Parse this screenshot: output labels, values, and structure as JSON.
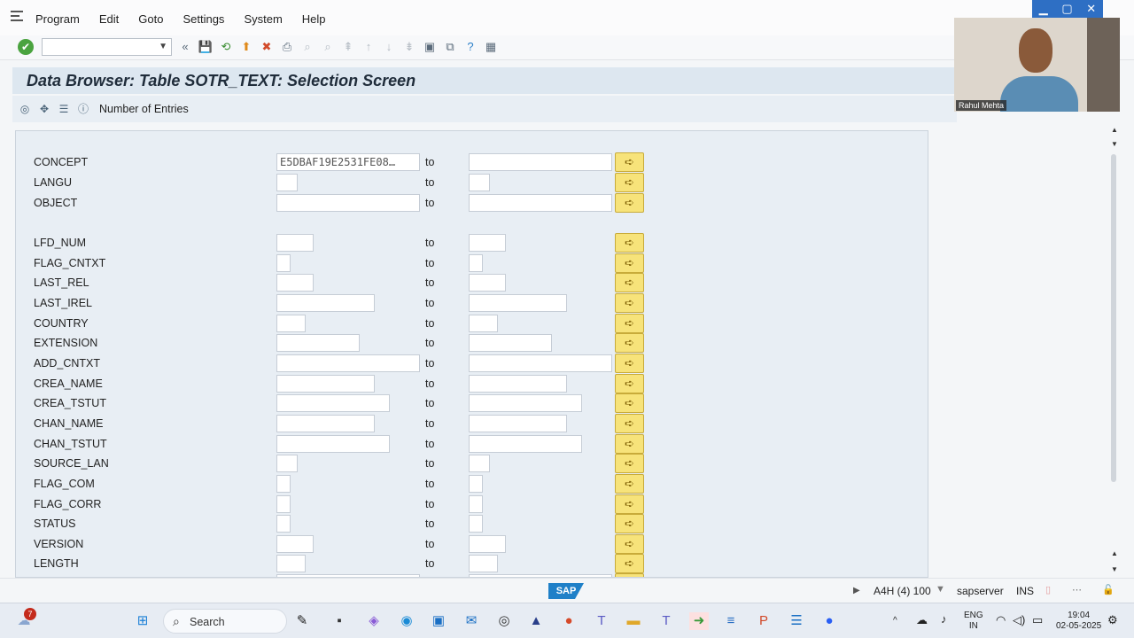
{
  "menubar": {
    "items": [
      "Program",
      "Edit",
      "Goto",
      "Settings",
      "System",
      "Help"
    ]
  },
  "window_controls": [
    "▁",
    "▢",
    "✕"
  ],
  "title": "Data Browser: Table SOTR_TEXT: Selection Screen",
  "app_toolbar": {
    "label": "Number of Entries"
  },
  "video": {
    "participant": "Rahul Mehta"
  },
  "selection": {
    "to_label": "to",
    "rows": [
      {
        "name": "CONCEPT",
        "from_value": "E5DBAF19E2531FE08…"
      },
      {
        "name": "LANGU",
        "from_value": ""
      },
      {
        "name": "OBJECT",
        "from_value": ""
      },
      {
        "name": "LFD_NUM",
        "from_value": ""
      },
      {
        "name": "FLAG_CNTXT",
        "from_value": ""
      },
      {
        "name": "LAST_REL",
        "from_value": ""
      },
      {
        "name": "LAST_IREL",
        "from_value": ""
      },
      {
        "name": "COUNTRY",
        "from_value": ""
      },
      {
        "name": "EXTENSION",
        "from_value": ""
      },
      {
        "name": "ADD_CNTXT",
        "from_value": ""
      },
      {
        "name": "CREA_NAME",
        "from_value": ""
      },
      {
        "name": "CREA_TSTUT",
        "from_value": ""
      },
      {
        "name": "CHAN_NAME",
        "from_value": ""
      },
      {
        "name": "CHAN_TSTUT",
        "from_value": ""
      },
      {
        "name": "SOURCE_LAN",
        "from_value": ""
      },
      {
        "name": "FLAG_COM",
        "from_value": ""
      },
      {
        "name": "FLAG_CORR",
        "from_value": ""
      },
      {
        "name": "STATUS",
        "from_value": ""
      },
      {
        "name": "VERSION",
        "from_value": ""
      },
      {
        "name": "LENGTH",
        "from_value": ""
      }
    ]
  },
  "statusbar": {
    "logo": "SAP",
    "system": "A4H (4) 100",
    "server": "sapserver",
    "mode": "INS"
  },
  "taskbar": {
    "search_placeholder": "Search",
    "notification_count": "7",
    "lang_line1": "ENG",
    "lang_line2": "IN",
    "time": "19:04",
    "date": "02-05-2025"
  },
  "colors": {
    "title_bg": "#dde7f0",
    "frame_bg": "#e8eef4",
    "multi_select_btn": "#f7e37a",
    "ok_green": "#4aa33f",
    "window_ctrl_blue": "#2e6fc4"
  }
}
